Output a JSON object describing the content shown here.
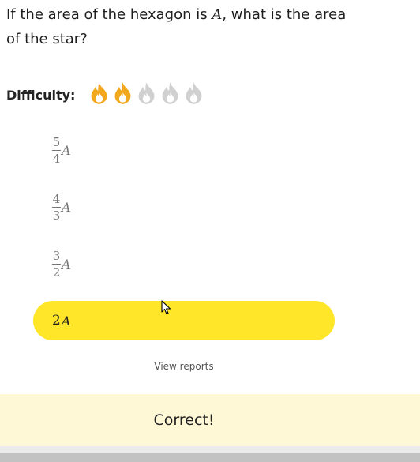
{
  "question": {
    "line_prefix": "If the area of the hexagon is ",
    "variable": "A",
    "line_suffix": ", what is the area",
    "line2": "of the star?"
  },
  "difficulty": {
    "label": "Difficulty:",
    "level": 2,
    "max": 5,
    "active_color": "#f2a81d",
    "inactive_color": "#d0d0d0",
    "icon": "flame-icon"
  },
  "choices": [
    {
      "numerator": "5",
      "denominator": "4",
      "variable": "A",
      "selected": false
    },
    {
      "numerator": "4",
      "denominator": "3",
      "variable": "A",
      "selected": false
    },
    {
      "numerator": "3",
      "denominator": "2",
      "variable": "A",
      "selected": false
    },
    {
      "coefficient": "2",
      "variable": "A",
      "selected": true
    }
  ],
  "selected_color": "#ffe629",
  "view_reports": "View reports",
  "feedback": {
    "text": "Correct!",
    "background": "#fff8d6"
  }
}
